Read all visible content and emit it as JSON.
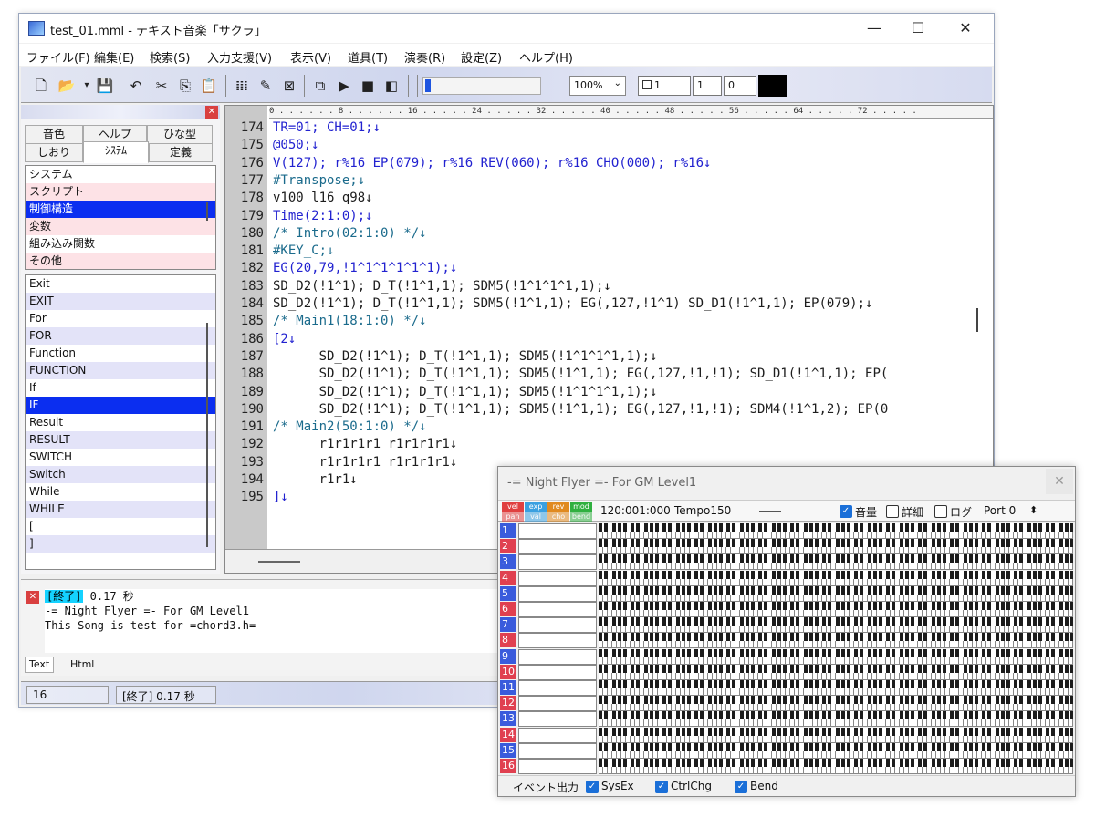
{
  "window": {
    "title": "test_01.mml - テキスト音楽「サクラ」",
    "min": "—",
    "max": "☐",
    "close": "✕"
  },
  "menu": [
    "ファイル(F)",
    "編集(E)",
    "検索(S)",
    "入力支援(V)",
    "表示(V)",
    "道具(T)",
    "演奏(R)",
    "設定(Z)",
    "ヘルプ(H)"
  ],
  "toolbar": {
    "icons": [
      "new-file-icon",
      "open-file-icon",
      "dropdown-arrow-icon",
      "save-icon",
      "undo-icon",
      "cut-icon",
      "copy-icon",
      "paste-icon",
      "piano-icon",
      "pen-icon",
      "image-icon",
      "play-from-cursor-icon",
      "play-icon",
      "stop-icon",
      "rewind-icon"
    ],
    "zoom": "100%",
    "num1": "1",
    "num2": "1",
    "num3": "0",
    "swatch_color": "#000000"
  },
  "left_panel": {
    "tabs_row1": [
      "音色",
      "ヘルプ",
      "ひな型"
    ],
    "tabs_row2": [
      "しおり",
      "ｼｽﾃﾑ",
      "定義"
    ],
    "categories": [
      {
        "label": "システム",
        "style": "plain"
      },
      {
        "label": "スクリプト",
        "style": "pink"
      },
      {
        "label": "制御構造",
        "style": "sel"
      },
      {
        "label": "変数",
        "style": "pink"
      },
      {
        "label": "組み込み関数",
        "style": "plain"
      },
      {
        "label": "その他",
        "style": "pink"
      }
    ],
    "keywords": [
      {
        "label": "Exit",
        "style": "plain"
      },
      {
        "label": "EXIT",
        "style": "lav"
      },
      {
        "label": "For",
        "style": "plain"
      },
      {
        "label": "FOR",
        "style": "lav"
      },
      {
        "label": "Function",
        "style": "plain"
      },
      {
        "label": "FUNCTION",
        "style": "lav"
      },
      {
        "label": "If",
        "style": "plain"
      },
      {
        "label": "IF",
        "style": "sel"
      },
      {
        "label": "Result",
        "style": "plain"
      },
      {
        "label": "RESULT",
        "style": "lav"
      },
      {
        "label": "SWITCH",
        "style": "plain"
      },
      {
        "label": "Switch",
        "style": "lav"
      },
      {
        "label": "While",
        "style": "plain"
      },
      {
        "label": "WHILE",
        "style": "lav"
      },
      {
        "label": "[",
        "style": "plain"
      },
      {
        "label": "]",
        "style": "lav"
      }
    ]
  },
  "editor": {
    "ruler": "0 . . . . . . 8 . . . . . . 16 . . . . . 24 . . . . . 32 . . . . . 40 . . . . . 48 . . . . . 56 . . . . . 64 . . . . . 72 . . . . .",
    "lines": [
      {
        "num": "174",
        "text": "TR=01; CH=01;↓",
        "color": "blue"
      },
      {
        "num": "175",
        "text": "@050;↓",
        "color": "blue"
      },
      {
        "num": "176",
        "text": "V(127); r%16 EP(079); r%16 REV(060); r%16 CHO(000); r%16↓",
        "color": "blue"
      },
      {
        "num": "177",
        "text": "#Transpose;↓",
        "color": "green"
      },
      {
        "num": "178",
        "text": "v100 l16 q98↓",
        "color": "plain"
      },
      {
        "num": "179",
        "text": "Time(2:1:0);↓",
        "color": "blue"
      },
      {
        "num": "180",
        "text": "/* Intro(02:1:0) */↓",
        "color": "green"
      },
      {
        "num": "181",
        "text": "#KEY_C;↓",
        "color": "green"
      },
      {
        "num": "182",
        "text": "EG(20,79,!1^1^1^1^1^1);↓",
        "color": "blue"
      },
      {
        "num": "183",
        "text": "SD_D2(!1^1); D_T(!1^1,1); SDM5(!1^1^1^1,1);↓",
        "color": "plain"
      },
      {
        "num": "184",
        "text": "SD_D2(!1^1); D_T(!1^1,1); SDM5(!1^1,1); EG(,127,!1^1) SD_D1(!1^1,1); EP(079);↓",
        "color": "plain"
      },
      {
        "num": "185",
        "text": "/* Main1(18:1:0) */↓",
        "color": "green"
      },
      {
        "num": "186",
        "text": "[2↓",
        "color": "blue"
      },
      {
        "num": "187",
        "text": "      SD_D2(!1^1); D_T(!1^1,1); SDM5(!1^1^1^1,1);↓",
        "color": "plain"
      },
      {
        "num": "188",
        "text": "      SD_D2(!1^1); D_T(!1^1,1); SDM5(!1^1,1); EG(,127,!1,!1); SD_D1(!1^1,1); EP(",
        "color": "plain"
      },
      {
        "num": "189",
        "text": "      SD_D2(!1^1); D_T(!1^1,1); SDM5(!1^1^1^1,1);↓",
        "color": "plain"
      },
      {
        "num": "190",
        "text": "      SD_D2(!1^1); D_T(!1^1,1); SDM5(!1^1,1); EG(,127,!1,!1); SDM4(!1^1,2); EP(0",
        "color": "plain"
      },
      {
        "num": "191",
        "text": "/* Main2(50:1:0) */↓",
        "color": "green"
      },
      {
        "num": "192",
        "text": "      r1r1r1r1 r1r1r1r1↓",
        "color": "plain"
      },
      {
        "num": "193",
        "text": "      r1r1r1r1 r1r1r1r1↓",
        "color": "plain"
      },
      {
        "num": "194",
        "text": "      r1r1↓",
        "color": "plain"
      },
      {
        "num": "195",
        "text": "]↓",
        "color": "blue"
      }
    ]
  },
  "output": {
    "done": "[終了]",
    "time": " 0.17 秒",
    "line2": "-= Night Flyer =- For GM Level1",
    "line3": "This Song is test for =chord3.h=",
    "tabs": [
      "Text",
      "Html"
    ]
  },
  "statusbar": {
    "line": "16",
    "message": "[終了] 0.17 秒"
  },
  "float_window": {
    "title": "-= Night Flyer =- For GM Level1",
    "legend_top": [
      "vel",
      "exp",
      "rev",
      "mod"
    ],
    "legend_bottom": [
      "pan",
      "val",
      "cho",
      "bend"
    ],
    "legend_colors": [
      "#e04040",
      "#3aa0e0",
      "#e08a20",
      "#30b040"
    ],
    "position": "120:001:000",
    "tempo": "Tempo150",
    "check_sound": {
      "label": "音量",
      "checked": true
    },
    "check_detail": {
      "label": "詳細",
      "checked": false
    },
    "check_log": {
      "label": "ログ",
      "checked": false
    },
    "port": "Port 0",
    "channels": [
      {
        "num": "1",
        "color": "#3a5bdc"
      },
      {
        "num": "2",
        "color": "#e04050"
      },
      {
        "num": "3",
        "color": "#3a5bdc"
      },
      {
        "num": "4",
        "color": "#e04050"
      },
      {
        "num": "5",
        "color": "#3a5bdc"
      },
      {
        "num": "6",
        "color": "#e04050"
      },
      {
        "num": "7",
        "color": "#3a5bdc"
      },
      {
        "num": "8",
        "color": "#e04050"
      },
      {
        "num": "9",
        "color": "#3a5bdc"
      },
      {
        "num": "10",
        "color": "#e04050"
      },
      {
        "num": "11",
        "color": "#3a5bdc"
      },
      {
        "num": "12",
        "color": "#e04050"
      },
      {
        "num": "13",
        "color": "#3a5bdc"
      },
      {
        "num": "14",
        "color": "#e04050"
      },
      {
        "num": "15",
        "color": "#3a5bdc"
      },
      {
        "num": "16",
        "color": "#e04050"
      }
    ],
    "footer_label": "イベント出力",
    "footer_checks": [
      {
        "label": "SysEx",
        "checked": true
      },
      {
        "label": "CtrlChg",
        "checked": true
      },
      {
        "label": "Bend",
        "checked": true
      }
    ]
  }
}
